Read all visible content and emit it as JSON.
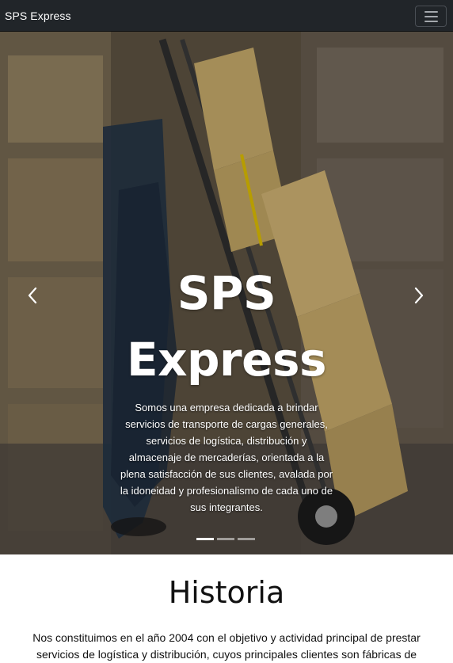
{
  "navbar": {
    "brand": "SPS Express",
    "toggler_icon": "hamburger-menu-icon"
  },
  "carousel": {
    "title_line1": "SPS",
    "title_line2": "Express",
    "description": "Somos una empresa dedicada a brindar servicios de transporte de cargas generales, servicios de logística, distribución y almacenaje de mercaderías, orientada a la plena satisfacción de sus clientes, avalada por la idoneidad y profesionalismo de cada uno de sus integrantes.",
    "prev_icon": "chevron-left-icon",
    "next_icon": "chevron-right-icon",
    "slide_count": 3,
    "active_slide": 1
  },
  "historia": {
    "title": "Historia",
    "text": "Nos constituimos en el año 2004 con el objetivo y actividad principal de prestar servicios de logística y distribución, cuyos principales clientes son fábricas de"
  }
}
